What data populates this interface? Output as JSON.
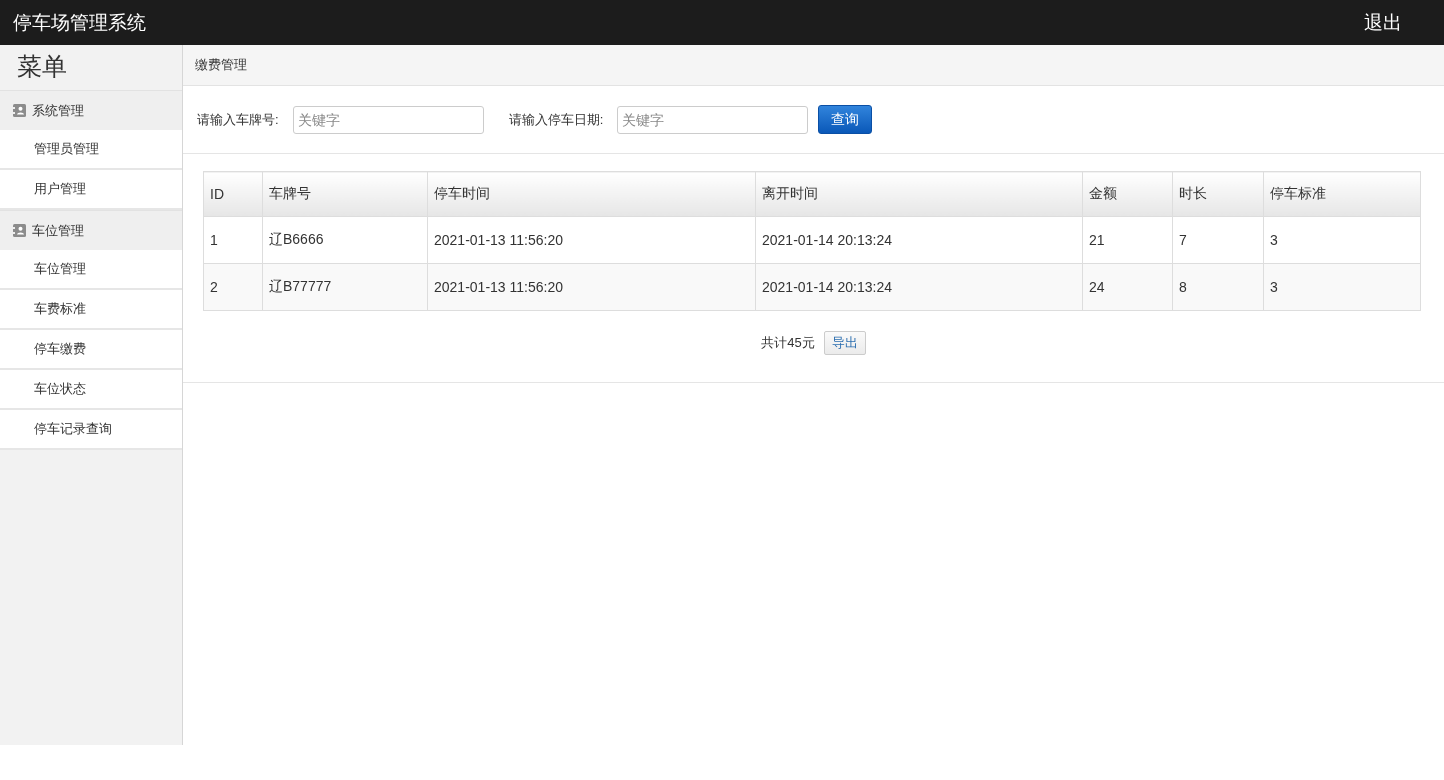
{
  "header": {
    "title": "停车场管理系统",
    "logout": "退出"
  },
  "sidebar": {
    "title": "菜单",
    "items": [
      {
        "label": "系统管理",
        "children": [
          {
            "label": "管理员管理"
          },
          {
            "label": "用户管理"
          }
        ]
      },
      {
        "label": "车位管理",
        "children": [
          {
            "label": "车位管理"
          },
          {
            "label": "车费标准"
          },
          {
            "label": "停车缴费"
          },
          {
            "label": "车位状态"
          },
          {
            "label": "停车记录查询"
          }
        ]
      }
    ]
  },
  "breadcrumb": "缴费管理",
  "search": {
    "fields": [
      {
        "label": "请输入车牌号:",
        "placeholder": "关键字"
      },
      {
        "label": "请输入停车日期:",
        "placeholder": "关键字"
      }
    ],
    "button": "查询"
  },
  "table": {
    "columns": [
      "ID",
      "车牌号",
      "停车时间",
      "离开时间",
      "金额",
      "时长",
      "停车标准"
    ],
    "rows": [
      [
        "1",
        "辽B6666",
        "2021-01-13 11:56:20",
        "2021-01-14 20:13:24",
        "21",
        "7",
        "3"
      ],
      [
        "2",
        "辽B77777",
        "2021-01-13 11:56:20",
        "2021-01-14 20:13:24",
        "24",
        "8",
        "3"
      ]
    ]
  },
  "summary": {
    "total": "共计45元",
    "export_button": "导出"
  }
}
